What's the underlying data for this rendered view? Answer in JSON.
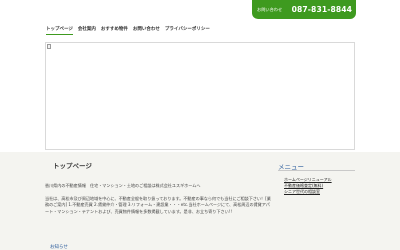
{
  "header": {
    "contact_label": "お問い合わせ",
    "phone": "087-831-8844",
    "accent_color": "#3e9a1f"
  },
  "nav": {
    "items": [
      "トップページ",
      "会社案内",
      "おすすめ物件",
      "お問い合わせ",
      "プライバシーポリシー"
    ],
    "active": "トップページ"
  },
  "main_image": {
    "icon": "broken-image-icon"
  },
  "content": {
    "title": "トップページ",
    "intro": "香川県内の不動産情報　住宅・マンション・土地のご相談は株式会社ユスギホームへ",
    "body": "当社は、高松市及び周辺地域を中心に、不動産全般を取り扱っております。不動産の事なら何でも当社にご相談下さい！[業務のご案内] 1.不動産売買 2.賃貸仲介・管理 3.リフォーム・建設業・・・etc.当社ホームページにて、高松周辺の賃貸アパート・マンション・テナントおよび、売買物件情報を多数掲載しています。是非、お立ち寄り下さい!!"
  },
  "sidebar": {
    "title": "メニュー",
    "links": [
      "ホームページリニューアル",
      "不動産価格査定(無料)",
      "シニア世代の相談室"
    ]
  },
  "footer": {
    "label": "お知らせ"
  }
}
